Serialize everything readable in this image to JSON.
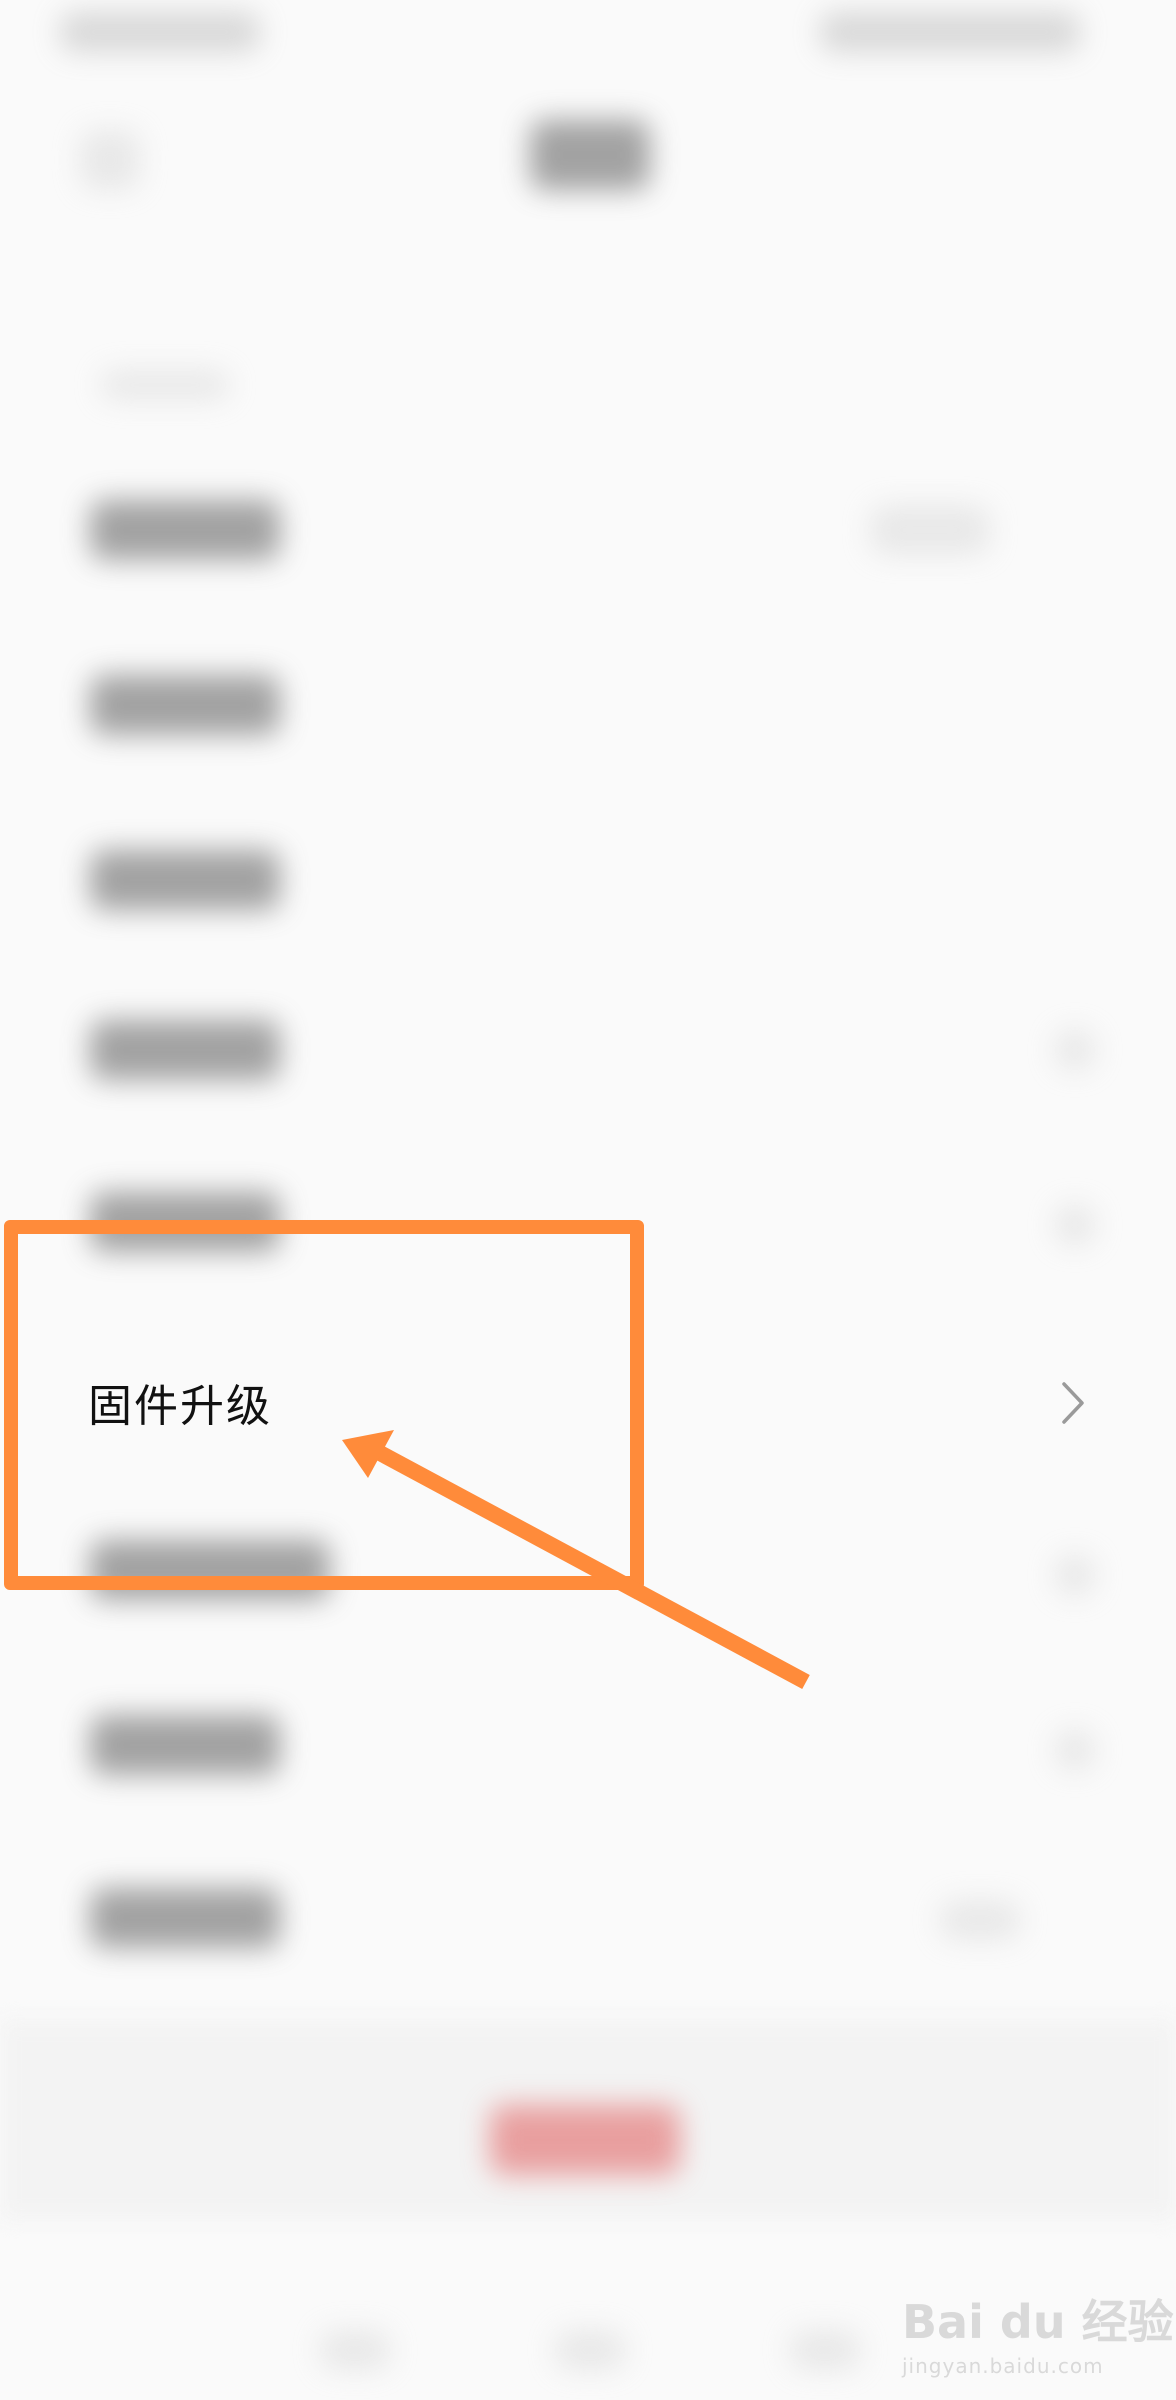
{
  "list": {
    "highlighted_item": {
      "label": "固件升级",
      "chevron": "chevron-right-icon"
    }
  },
  "annotation": {
    "color": "#ff8b3a",
    "arrow_icon": "arrow-icon"
  },
  "watermark": {
    "text": "Bai du 经验",
    "url_text": "jingyan.baidu.com"
  },
  "colors": {
    "background": "#fafafa",
    "accent_blurred": "#e05a5a",
    "annotation": "#ff8b3a"
  }
}
